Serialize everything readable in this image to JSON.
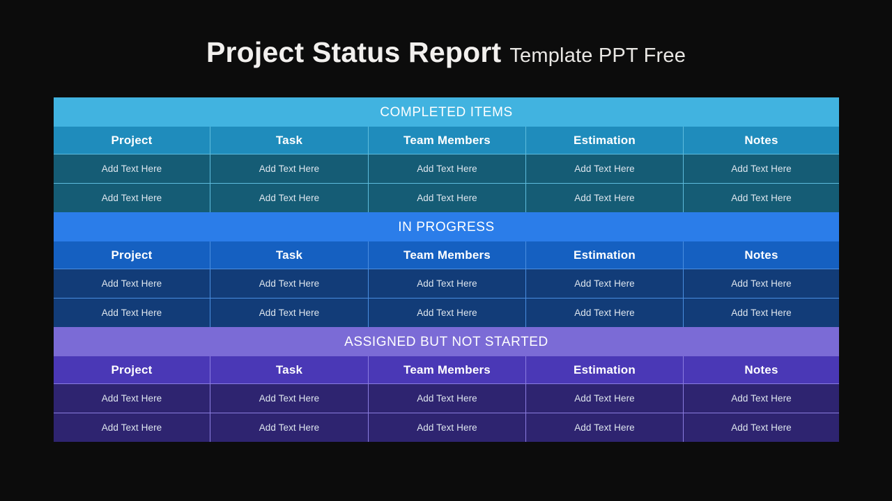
{
  "slide": {
    "background_color": "#0c0c0c"
  },
  "title": {
    "main": "Project Status Report",
    "sub": "Template PPT Free"
  },
  "table": {
    "columns": [
      "Project",
      "Task",
      "Team Members",
      "Estimation",
      "Notes"
    ],
    "sections": [
      {
        "id": "completed",
        "banner": "COMPLETED ITEMS",
        "banner_color": "#41b3e0",
        "header_color": "#1f8cbc",
        "row_color": "#155c75",
        "divider_color": "#5ebcdd",
        "columns": [
          "Project",
          "Task",
          "Team Members",
          "Estimation",
          "Notes"
        ],
        "rows": [
          [
            "Add Text Here",
            "Add Text Here",
            "Add Text Here",
            "Add Text Here",
            "Add Text Here"
          ],
          [
            "Add Text Here",
            "Add Text Here",
            "Add Text Here",
            "Add Text Here",
            "Add Text Here"
          ]
        ]
      },
      {
        "id": "progress",
        "banner": "IN PROGRESS",
        "banner_color": "#2b7de9",
        "header_color": "#1560c1",
        "row_color": "#123c78",
        "divider_color": "#4a8ee0",
        "columns": [
          "Project",
          "Task",
          "Team Members",
          "Estimation",
          "Notes"
        ],
        "rows": [
          [
            "Add Text Here",
            "Add Text Here",
            "Add Text Here",
            "Add Text Here",
            "Add Text Here"
          ],
          [
            "Add Text Here",
            "Add Text Here",
            "Add Text Here",
            "Add Text Here",
            "Add Text Here"
          ]
        ]
      },
      {
        "id": "assigned",
        "banner": "ASSIGNED BUT NOT STARTED",
        "banner_color": "#7b6bd6",
        "header_color": "#4a38b6",
        "row_color": "#2e2470",
        "divider_color": "#8b7de0",
        "columns": [
          "Project",
          "Task",
          "Team Members",
          "Estimation",
          "Notes"
        ],
        "rows": [
          [
            "Add Text Here",
            "Add Text Here",
            "Add Text Here",
            "Add Text Here",
            "Add Text Here"
          ],
          [
            "Add Text Here",
            "Add Text Here",
            "Add Text Here",
            "Add Text Here",
            "Add Text Here"
          ]
        ]
      }
    ]
  }
}
